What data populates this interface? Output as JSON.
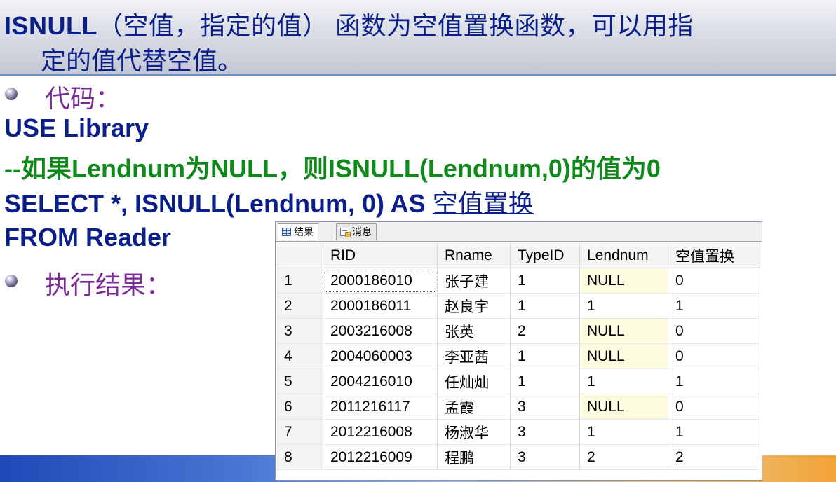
{
  "header": {
    "line1_bold": "ISNULL",
    "line1_rest": "（空值，指定的值） 函数为空值置换函数，可以用指",
    "line2": "定的值代替空值。"
  },
  "code_label": "代码：",
  "code": {
    "line1": "USE  Library",
    "line2": "--如果Lendnum为NULL，则ISNULL(Lendnum,0)的值为0",
    "line3_main": "SELECT   *, ISNULL(Lendnum, 0)  AS ",
    "line3_alias": "空值置换",
    "line4": "FROM  Reader"
  },
  "result_label": "执行结果：",
  "grid": {
    "tabs": [
      {
        "label": "结果",
        "icon": "grid-icon"
      },
      {
        "label": "消息",
        "icon": "message-icon"
      }
    ],
    "columns": [
      "",
      "RID",
      "Rname",
      "TypeID",
      "Lendnum",
      "空值置换"
    ],
    "rows": [
      [
        "1",
        "2000186010",
        "张子建",
        "1",
        "NULL",
        "0"
      ],
      [
        "2",
        "2000186011",
        "赵良宇",
        "1",
        "1",
        "1"
      ],
      [
        "3",
        "2003216008",
        "张英",
        "2",
        "NULL",
        "0"
      ],
      [
        "4",
        "2004060003",
        "李亚茜",
        "1",
        "NULL",
        "0"
      ],
      [
        "5",
        "2004216010",
        "任灿灿",
        "1",
        "1",
        "1"
      ],
      [
        "6",
        "2011216117",
        "孟霞",
        "3",
        "NULL",
        "0"
      ],
      [
        "7",
        "2012216008",
        "杨淑华",
        "3",
        "1",
        "1"
      ],
      [
        "8",
        "2012216009",
        "程鹏",
        "3",
        "2",
        "2"
      ]
    ]
  },
  "colors": {
    "title_navy": "#0b1f8a",
    "comment_green": "#0f8a1a",
    "label_purple": "#7b2a9a",
    "null_cell_bg": "#fdfbe0"
  }
}
